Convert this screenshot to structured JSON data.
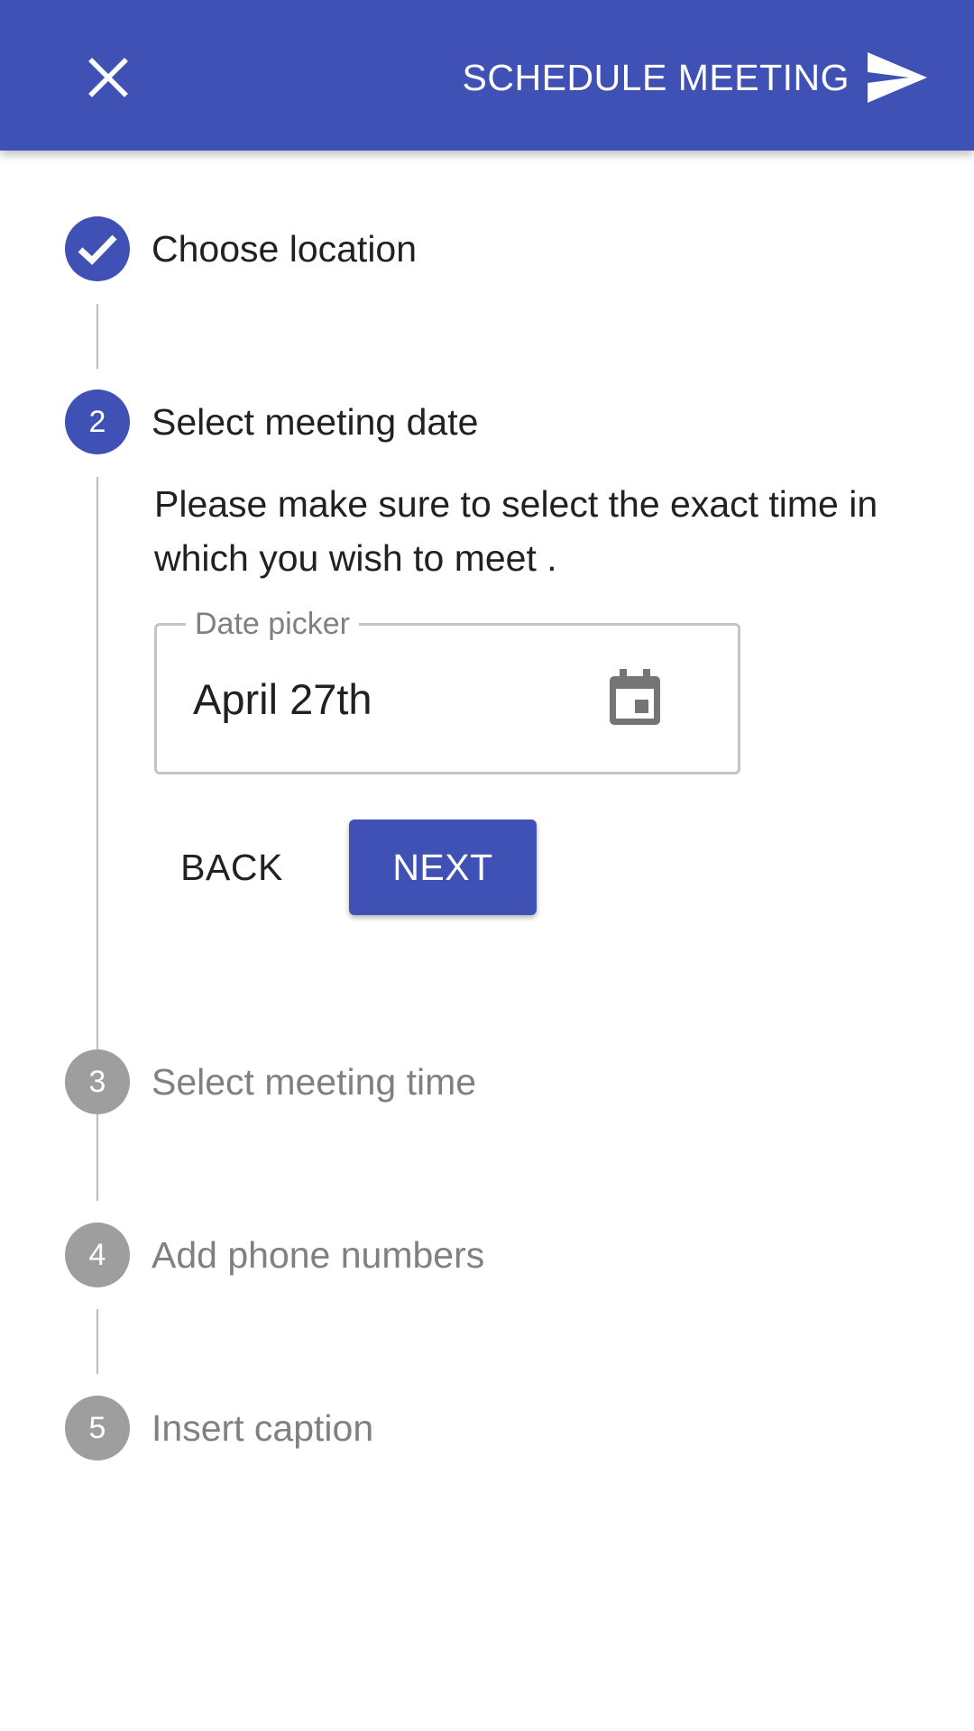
{
  "app_bar": {
    "close_icon": "close-icon",
    "action_label": "SCHEDULE MEETING",
    "action_icon": "send-icon",
    "color": "#3f51b5"
  },
  "steps": [
    {
      "number": "1",
      "label": "Choose location",
      "state": "completed",
      "icon": "check-icon"
    },
    {
      "number": "2",
      "label": "Select meeting date",
      "state": "active"
    },
    {
      "number": "3",
      "label": "Select meeting time",
      "state": "inactive"
    },
    {
      "number": "4",
      "label": "Add phone numbers",
      "state": "inactive"
    },
    {
      "number": "5",
      "label": "Insert caption",
      "state": "inactive"
    }
  ],
  "active_step": {
    "instructions": "Please make sure to select the exact time in which you wish to meet .",
    "date_field": {
      "label": "Date picker",
      "value": "April 27th",
      "icon": "calendar-icon"
    },
    "back_label": "BACK",
    "next_label": "NEXT"
  },
  "colors": {
    "primary": "#3f51b5",
    "inactive": "#9e9e9e",
    "text": "#212121",
    "muted_text": "#808080"
  }
}
